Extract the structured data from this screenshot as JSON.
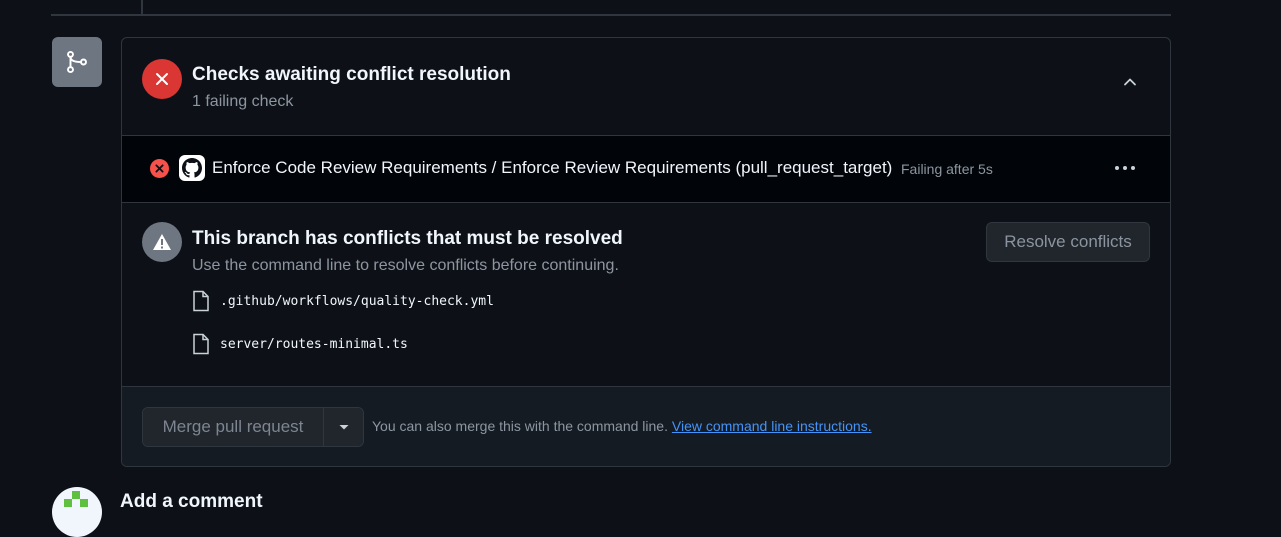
{
  "checks": {
    "title": "Checks awaiting conflict resolution",
    "subtitle": "1 failing check",
    "items": [
      {
        "name": "Enforce Code Review Requirements / Enforce Review Requirements (pull_request_target)",
        "status": "Failing after 5s"
      }
    ]
  },
  "conflicts": {
    "title": "This branch has conflicts that must be resolved",
    "subtitle": "Use the command line to resolve conflicts before continuing.",
    "resolve_label": "Resolve conflicts",
    "files": [
      ".github/workflows/quality-check.yml",
      "server/routes-minimal.ts"
    ]
  },
  "merge": {
    "button_label": "Merge pull request",
    "note": "You can also merge this with the command line. ",
    "link_label": "View command line instructions."
  },
  "comment": {
    "heading": "Add a comment"
  },
  "colors": {
    "failure": "#da3633",
    "link": "#4493f8",
    "neutral_badge": "#6e7681"
  }
}
